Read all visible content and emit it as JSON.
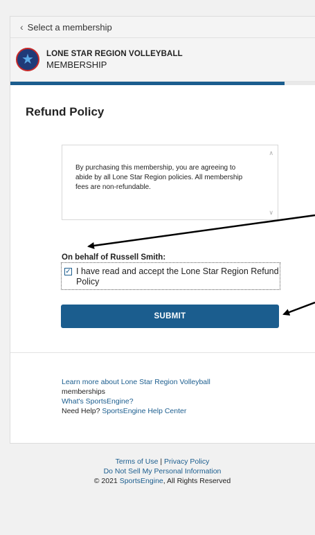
{
  "nav": {
    "back_label": "Select a membership"
  },
  "brand": {
    "org": "LONE STAR REGION VOLLEYBALL",
    "subtitle": "MEMBERSHIP"
  },
  "progress": {
    "fraction": 0.9
  },
  "section": {
    "title": "Refund Policy"
  },
  "policy": {
    "text": "By purchasing this membership, you are agreeing to abide by all Lone Star Region policies. All membership fees are non-refundable."
  },
  "consent": {
    "behalf_label": "On behalf of Russell Smith:",
    "checkbox_label": "I have read and accept the Lone Star Region Refund Policy",
    "checked": true
  },
  "actions": {
    "submit_label": "SUBMIT"
  },
  "help": {
    "learn_more_link": "Learn more about Lone Star Region Volleyball",
    "learn_more_tail": "memberships",
    "whats_link": "What's SportsEngine?",
    "need_help_label": "Need Help?",
    "help_center_link": "SportsEngine Help Center"
  },
  "footer": {
    "terms": "Terms of Use",
    "sep": "|",
    "privacy": "Privacy Policy",
    "do_not_sell": "Do Not Sell My Personal Information",
    "copyright_prefix": "© 2021",
    "brand_link": "SportsEngine",
    "copyright_suffix": ", All Rights Reserved"
  },
  "colors": {
    "accent": "#1b5d8e",
    "background": "#f1f1f1"
  },
  "icons": {
    "back": "chevron-left-icon",
    "check": "checkmark-icon",
    "logo": "star-logo-icon"
  }
}
